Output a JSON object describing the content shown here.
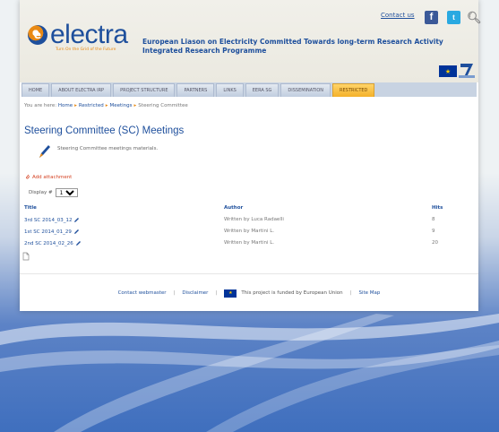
{
  "header": {
    "logo_text": "electra",
    "logo_tagline": "Turn On the Grid of the Future",
    "title_line1": "European Liason on Electricity Committed Towards long-term Research Activity",
    "title_line2": "Integrated Research Programme",
    "contact_us": "Contact us",
    "icons": [
      "facebook-icon",
      "twitter-icon",
      "search-icon",
      "eu-flag-icon",
      "seventh-framework-icon"
    ]
  },
  "nav": {
    "items": [
      {
        "label": "HOME"
      },
      {
        "label": "ABOUT ELECTRA IRP"
      },
      {
        "label": "PROJECT STRUCTURE"
      },
      {
        "label": "PARTNERS"
      },
      {
        "label": "LINKS"
      },
      {
        "label": "EERA SG"
      },
      {
        "label": "DISSEMINATION"
      },
      {
        "label": "RESTRICTED"
      }
    ],
    "active": "RESTRICTED"
  },
  "breadcrumb": {
    "prefix": "You are here:",
    "items": [
      "Home",
      "Restricted",
      "Meetings",
      "Steering Committee"
    ]
  },
  "main": {
    "title": "Steering Committee (SC) Meetings",
    "description": "Steering Committee meetings materials.",
    "add_attachment": "Add attachment",
    "display_label": "Display #",
    "display_value": "10",
    "columns": {
      "title": "Title",
      "author": "Author",
      "hits": "Hits"
    },
    "rows": [
      {
        "title": "3rd SC 2014_03_12",
        "author": "Written by Luca Radaelli",
        "hits": "8"
      },
      {
        "title": "1st SC 2014_01_29",
        "author": "Written by Martini L.",
        "hits": "9"
      },
      {
        "title": "2nd SC 2014_02_26",
        "author": "Written by Martini L.",
        "hits": "20"
      }
    ]
  },
  "footer": {
    "contact_webmaster": "Contact webmaster",
    "disclaimer": "Disclaimer",
    "funded": "This project is funded by European Union",
    "site_map": "Site Map",
    "separator": "|"
  },
  "colors": {
    "brand_blue": "#1e4f9c",
    "brand_orange": "#e98a15",
    "active_tab": "#f4b12a",
    "link_red": "#d43f1f"
  }
}
